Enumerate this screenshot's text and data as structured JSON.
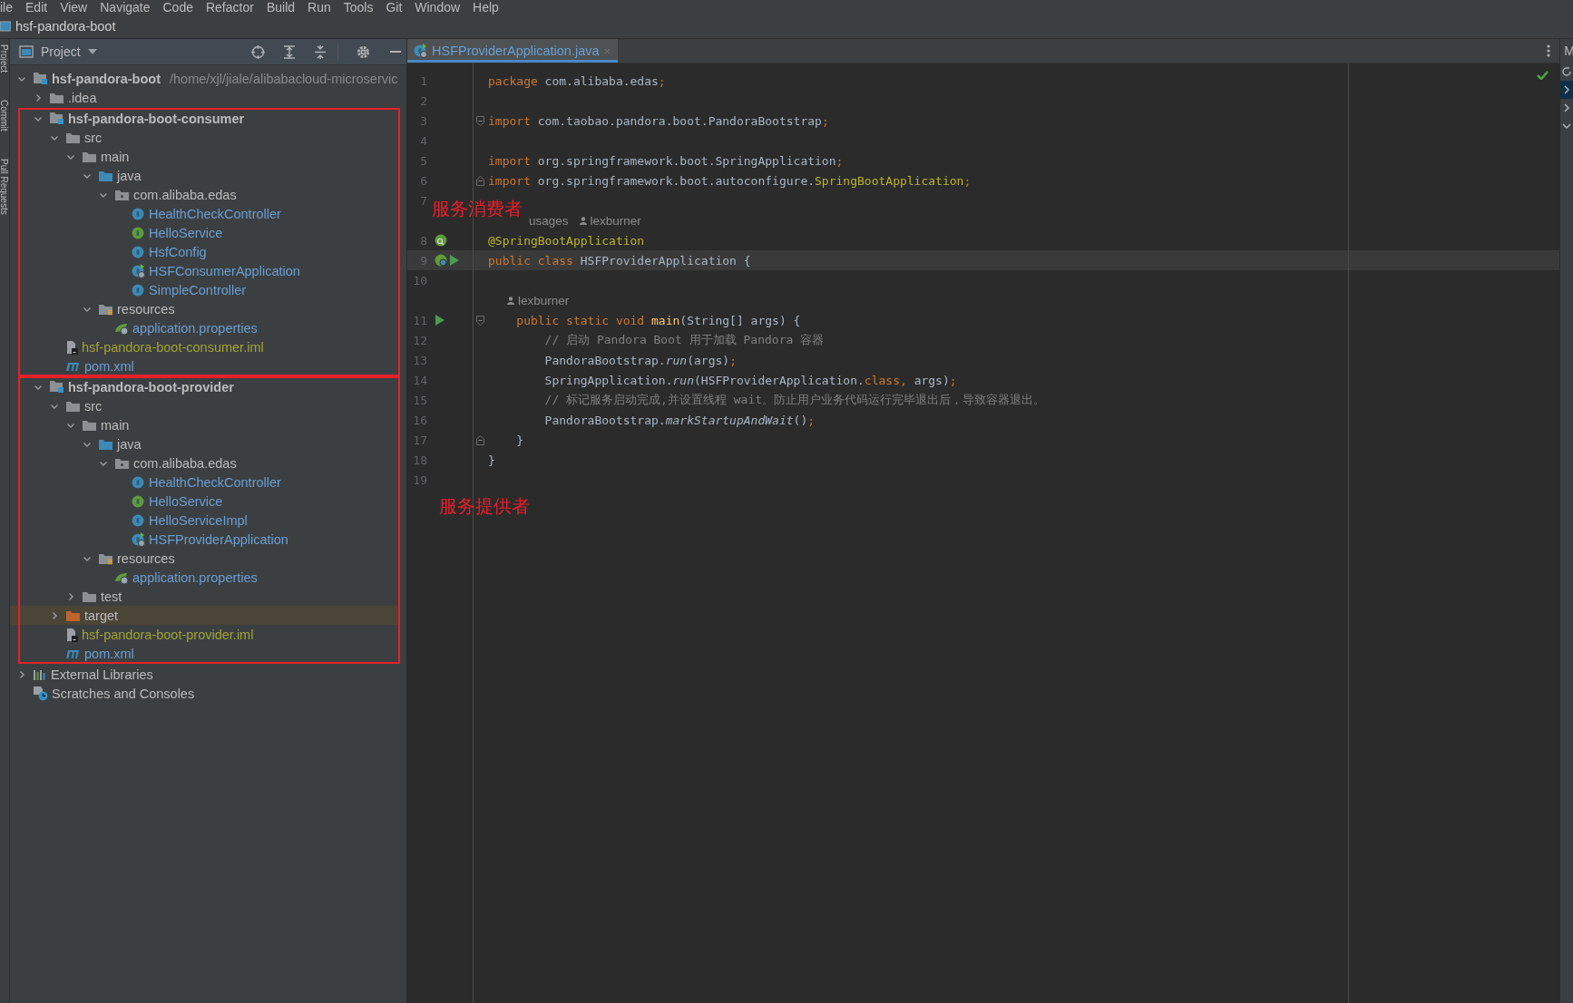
{
  "menu_bar": [
    "ile",
    "Edit",
    "View",
    "Navigate",
    "Code",
    "Refactor",
    "Build",
    "Run",
    "Tools",
    "Git",
    "Window",
    "Help"
  ],
  "window": {
    "title": "hsf-pandora-boot"
  },
  "left_strip": [
    "Project",
    "Commit",
    "Pull Requests"
  ],
  "project_panel": {
    "title": "Project",
    "tree": [
      {
        "label": "hsf-pandora-boot",
        "path": "/home/xjl/jiale/alibabacloud-microservic",
        "kind": "root",
        "expanded": true,
        "selected": false,
        "children": [
          {
            "label": ".idea",
            "kind": "folder",
            "expanded": false,
            "selected": false
          },
          {
            "label": "hsf-pandora-boot-consumer",
            "kind": "module",
            "boxed": true,
            "expanded": true,
            "selected": false,
            "children": [
              {
                "label": "src",
                "kind": "folder",
                "expanded": true,
                "selected": false,
                "children": [
                  {
                    "label": "main",
                    "kind": "folder",
                    "expanded": true,
                    "selected": false,
                    "children": [
                      {
                        "label": "java",
                        "kind": "source",
                        "expanded": true,
                        "selected": false,
                        "children": [
                          {
                            "label": "com.alibaba.edas",
                            "kind": "package",
                            "expanded": true,
                            "selected": false,
                            "children": [
                              {
                                "label": "HealthCheckController",
                                "kind": "class",
                                "selected": false
                              },
                              {
                                "label": "HelloService",
                                "kind": "interface",
                                "selected": false
                              },
                              {
                                "label": "HsfConfig",
                                "kind": "class",
                                "selected": false
                              },
                              {
                                "label": "HSFConsumerApplication",
                                "kind": "app",
                                "selected": false
                              },
                              {
                                "label": "SimpleController",
                                "kind": "class",
                                "selected": false
                              }
                            ]
                          }
                        ]
                      },
                      {
                        "label": "resources",
                        "kind": "resources",
                        "expanded": true,
                        "selected": false,
                        "children": [
                          {
                            "label": "application.properties",
                            "kind": "properties",
                            "selected": false
                          }
                        ]
                      }
                    ]
                  }
                ]
              },
              {
                "label": "hsf-pandora-boot-consumer.iml",
                "kind": "iml",
                "selected": false
              },
              {
                "label": "pom.xml",
                "kind": "pom",
                "selected": false
              }
            ]
          },
          {
            "label": "hsf-pandora-boot-provider",
            "kind": "module",
            "boxed": true,
            "expanded": true,
            "selected": false,
            "children": [
              {
                "label": "src",
                "kind": "folder",
                "expanded": true,
                "selected": false,
                "children": [
                  {
                    "label": "main",
                    "kind": "folder",
                    "expanded": true,
                    "selected": false,
                    "children": [
                      {
                        "label": "java",
                        "kind": "source",
                        "expanded": true,
                        "selected": false,
                        "children": [
                          {
                            "label": "com.alibaba.edas",
                            "kind": "package",
                            "expanded": true,
                            "selected": false,
                            "children": [
                              {
                                "label": "HealthCheckController",
                                "kind": "class",
                                "selected": false
                              },
                              {
                                "label": "HelloService",
                                "kind": "interface",
                                "selected": false
                              },
                              {
                                "label": "HelloServiceImpl",
                                "kind": "class",
                                "selected": false
                              },
                              {
                                "label": "HSFProviderApplication",
                                "kind": "app",
                                "selected": false
                              }
                            ]
                          }
                        ]
                      },
                      {
                        "label": "resources",
                        "kind": "resources",
                        "expanded": true,
                        "selected": false,
                        "children": [
                          {
                            "label": "application.properties",
                            "kind": "properties",
                            "selected": false
                          }
                        ]
                      }
                    ]
                  },
                  {
                    "label": "test",
                    "kind": "folder",
                    "expanded": false,
                    "selected": false
                  }
                ]
              },
              {
                "label": "target",
                "kind": "excluded",
                "expanded": false,
                "selected": true
              },
              {
                "label": "hsf-pandora-boot-provider.iml",
                "kind": "iml",
                "selected": false
              },
              {
                "label": "pom.xml",
                "kind": "pom",
                "selected": false
              }
            ]
          }
        ]
      },
      {
        "label": "External Libraries",
        "kind": "libraries",
        "expanded": false,
        "selected": false
      },
      {
        "label": "Scratches and Consoles",
        "kind": "scratches",
        "selected": false
      }
    ]
  },
  "editor": {
    "tab": {
      "label": "HSFProviderApplication.java",
      "close": "×",
      "selected": true
    },
    "lines": [
      {
        "kind": "code",
        "number": "1",
        "current": false,
        "tokens": [
          {
            "text": "package",
            "kind": "keyword"
          },
          {
            "text": " com.alibaba.edas",
            "kind": "plain"
          },
          {
            "text": ";",
            "kind": "punct"
          }
        ]
      },
      {
        "kind": "code",
        "number": "2",
        "current": false
      },
      {
        "kind": "code",
        "number": "3",
        "current": false,
        "gutter": [
          {
            "kind": "fold-start"
          }
        ],
        "tokens": [
          {
            "text": "import",
            "kind": "keyword"
          },
          {
            "text": " com.taobao.pandora.boot.PandoraBootstrap",
            "kind": "plain"
          },
          {
            "text": ";",
            "kind": "punct"
          }
        ]
      },
      {
        "kind": "code",
        "number": "4",
        "current": false
      },
      {
        "kind": "code",
        "number": "5",
        "current": false,
        "tokens": [
          {
            "text": "import",
            "kind": "keyword"
          },
          {
            "text": " org.springframework.boot.SpringApplication",
            "kind": "plain"
          },
          {
            "text": ";",
            "kind": "punct"
          }
        ]
      },
      {
        "kind": "code",
        "number": "6",
        "current": false,
        "gutter": [
          {
            "kind": "fold-end"
          }
        ],
        "tokens": [
          {
            "text": "import",
            "kind": "keyword"
          },
          {
            "text": " org.springframework.boot.autoconfigure.",
            "kind": "plain"
          },
          {
            "text": "SpringBootApplication",
            "kind": "annotation"
          },
          {
            "text": ";",
            "kind": "punct"
          }
        ]
      },
      {
        "kind": "code",
        "number": "7",
        "current": false
      },
      {
        "kind": "lens",
        "nested": false,
        "items": [
          {
            "kind": "usages",
            "text": "usages"
          },
          {
            "kind": "author",
            "text": "lexburner"
          }
        ]
      },
      {
        "kind": "code",
        "number": "8",
        "current": false,
        "gutter": [
          {
            "kind": "bean-search"
          }
        ],
        "tokens": [
          {
            "text": "@SpringBootApplication",
            "kind": "annotation"
          }
        ]
      },
      {
        "kind": "code",
        "number": "9",
        "current": true,
        "gutter": [
          {
            "kind": "bean"
          },
          {
            "kind": "run"
          }
        ],
        "tokens": [
          {
            "text": "public class",
            "kind": "keyword"
          },
          {
            "text": " HSFProviderApplication {",
            "kind": "plain"
          }
        ]
      },
      {
        "kind": "code",
        "number": "10",
        "current": false
      },
      {
        "kind": "lens",
        "nested": true,
        "items": [
          {
            "kind": "author",
            "text": "lexburner"
          }
        ]
      },
      {
        "kind": "code",
        "number": "11",
        "current": false,
        "gutter": [
          {
            "kind": "run"
          },
          {
            "kind": "fold-start"
          }
        ],
        "tokens": [
          {
            "text": "    public static void ",
            "kind": "keyword"
          },
          {
            "text": "main",
            "kind": "method"
          },
          {
            "text": "(String[] args) {",
            "kind": "plain"
          }
        ]
      },
      {
        "kind": "code",
        "number": "12",
        "current": false,
        "tokens": [
          {
            "text": "        // 启动 Pandora Boot 用于加载 Pandora 容器",
            "kind": "comment"
          }
        ]
      },
      {
        "kind": "code",
        "number": "13",
        "current": false,
        "tokens": [
          {
            "text": "        PandoraBootstrap.",
            "kind": "plain"
          },
          {
            "text": "run",
            "kind": "static"
          },
          {
            "text": "(args)",
            "kind": "plain"
          },
          {
            "text": ";",
            "kind": "punct"
          }
        ]
      },
      {
        "kind": "code",
        "number": "14",
        "current": false,
        "tokens": [
          {
            "text": "        SpringApplication.",
            "kind": "plain"
          },
          {
            "text": "run",
            "kind": "static"
          },
          {
            "text": "(HSFProviderApplication.",
            "kind": "plain"
          },
          {
            "text": "class, ",
            "kind": "keyword"
          },
          {
            "text": "args)",
            "kind": "plain"
          },
          {
            "text": ";",
            "kind": "punct"
          }
        ]
      },
      {
        "kind": "code",
        "number": "15",
        "current": false,
        "tokens": [
          {
            "text": "        // 标记服务启动完成,并设置线程 wait。防止用户业务代码运行完毕退出后，导致容器退出。",
            "kind": "comment"
          }
        ]
      },
      {
        "kind": "code",
        "number": "16",
        "current": false,
        "tokens": [
          {
            "text": "        PandoraBootstrap.",
            "kind": "plain"
          },
          {
            "text": "markStartupAndWait",
            "kind": "static"
          },
          {
            "text": "()",
            "kind": "plain"
          },
          {
            "text": ";",
            "kind": "punct"
          }
        ]
      },
      {
        "kind": "code",
        "number": "17",
        "current": false,
        "gutter": [
          {
            "kind": "fold-end"
          }
        ],
        "tokens": [
          {
            "text": "    }",
            "kind": "plain"
          }
        ]
      },
      {
        "kind": "code",
        "number": "18",
        "current": false,
        "tokens": [
          {
            "text": "}",
            "kind": "plain"
          }
        ]
      },
      {
        "kind": "code",
        "number": "19",
        "current": false
      }
    ]
  },
  "right_strip": {
    "label": "M"
  },
  "annotations": [
    {
      "text": "服务消费者",
      "kind": "consumer"
    },
    {
      "text": "服务提供者",
      "kind": "provider"
    }
  ]
}
